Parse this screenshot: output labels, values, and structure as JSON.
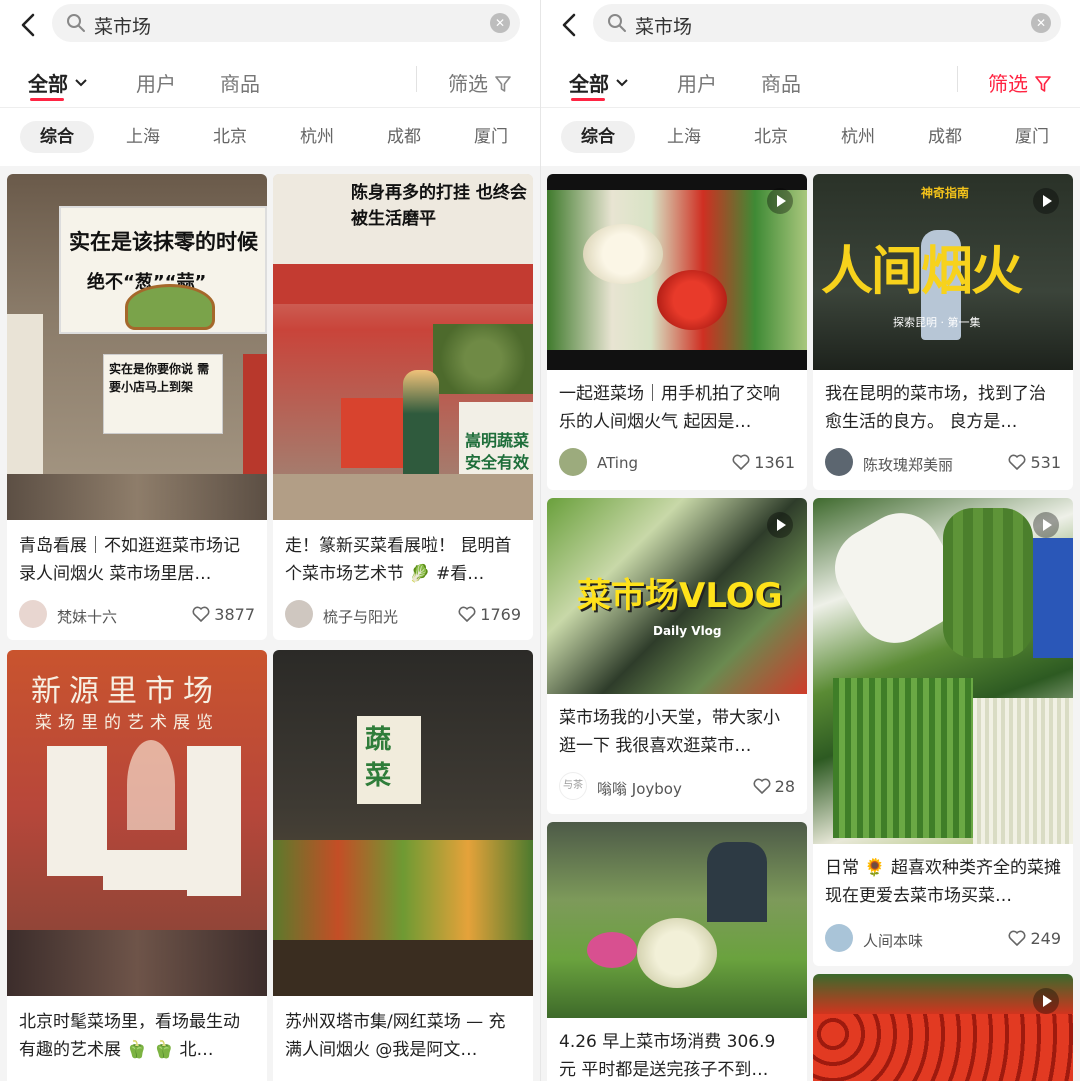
{
  "search": {
    "query": "菜市场"
  },
  "tabs": {
    "all": "全部",
    "users": "用户",
    "goods": "商品",
    "filter": "筛选"
  },
  "cities": [
    "综合",
    "上海",
    "北京",
    "杭州",
    "成都",
    "厦门"
  ],
  "left_cards": [
    {
      "title": "青岛看展｜不如逛逛菜市场记录人间烟火 菜市场里居…",
      "author": "梵妹十六",
      "likes": "3877"
    },
    {
      "title": "走！篆新买菜看展啦！ 昆明首个菜市场艺术节 🥬 #看…",
      "author": "梳子与阳光",
      "likes": "1769"
    },
    {
      "title": "北京时髦菜场里，看场最生动有趣的艺术展 🫑 🫑 北…"
    },
    {
      "title": "苏州双塔市集/网红菜场 — 充满人间烟火 @我是阿文…"
    }
  ],
  "right_cards": [
    {
      "title": "一起逛菜场｜用手机拍了交响乐的人间烟火气 起因是…",
      "author": "ATing",
      "likes": "1361"
    },
    {
      "title": "我在昆明的菜市场，找到了治愈生活的良方。 良方是…",
      "author": "陈玫瑰郑美丽",
      "likes": "531"
    },
    {
      "title": "菜市场我的小天堂，带大家小逛一下 我很喜欢逛菜市…",
      "author": "嗡嗡 Joyboy",
      "likes": "28",
      "avatar_text": "与茶"
    },
    {
      "title": "日常 🌻 超喜欢种类齐全的菜摊 现在更爱去菜市场买菜…",
      "author": "人间本味",
      "likes": "249"
    },
    {
      "title": "4.26 早上菜市场消费 306.9 元 平时都是送完孩子不到…"
    }
  ],
  "image_text": {
    "l1_sign1": "实在是该抹零的时候",
    "l1_sign2": "绝不“葱”“蒜”",
    "l1_sign3": "实在是你要你说 需要小店马上到架",
    "l2_banner": "陈身再多的打挂 也终会被生活磨平",
    "l2_sign": "嵩明蔬菜 安全有效",
    "l3_title": "新源里市场",
    "l3_sub": "菜场里的艺术展览",
    "l4_sign": "蔬菜",
    "r2_big": "人间烟火",
    "r2_small": "探索昆明 · 第一集",
    "r2_top": "神奇指南",
    "r3_vlog": "菜市场VLOG",
    "r3_daily": "Daily Vlog"
  },
  "colors": {
    "accent": "#ff2442"
  }
}
